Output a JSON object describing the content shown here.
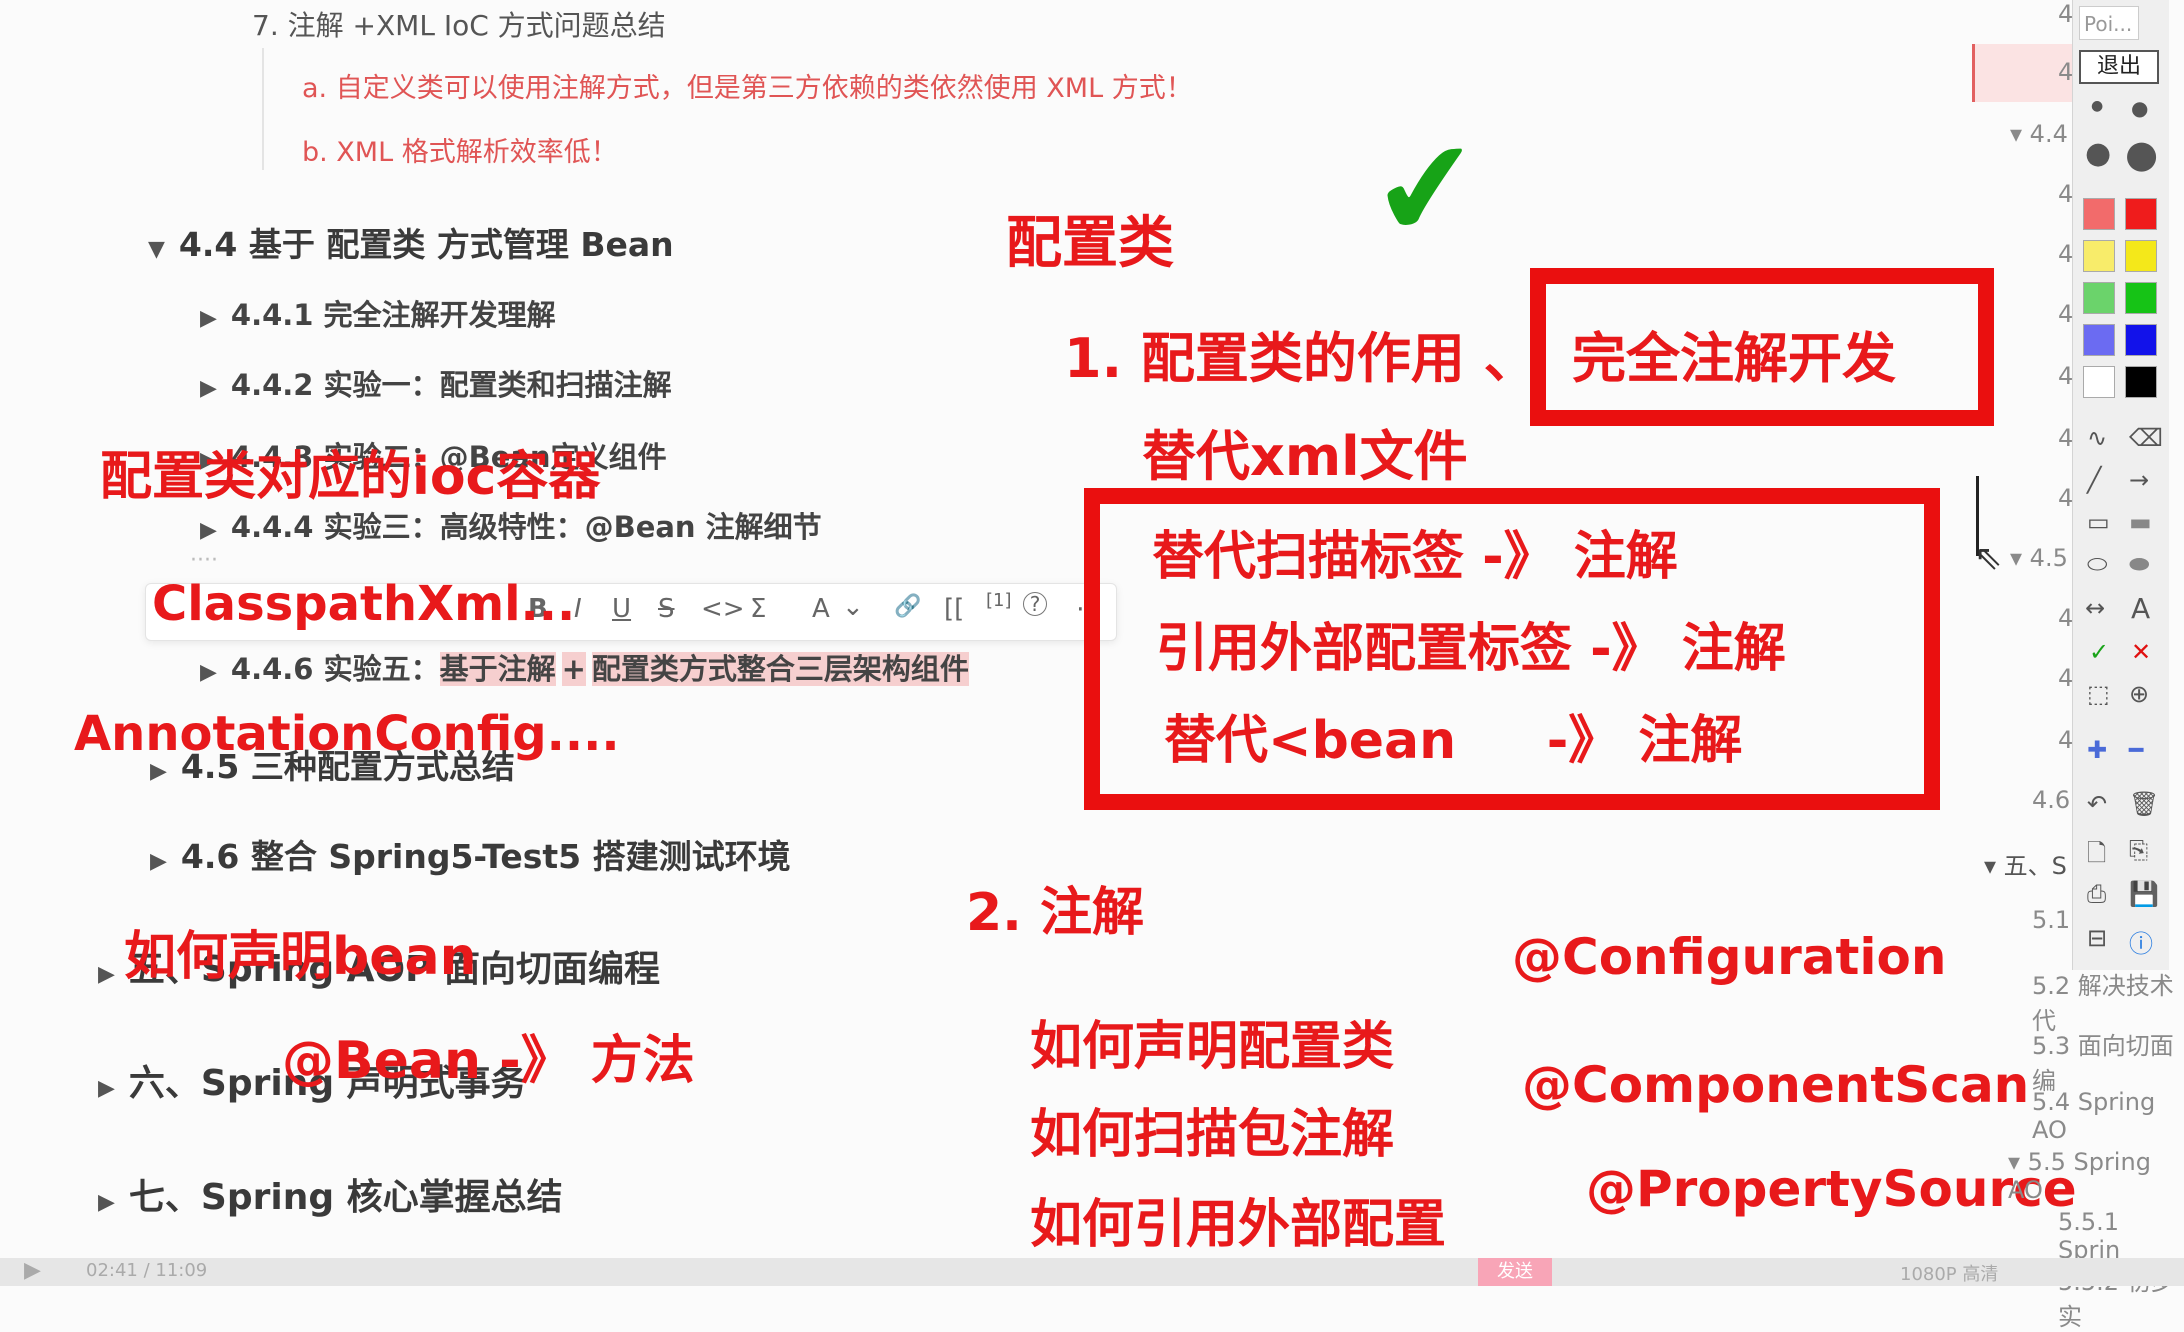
{
  "outline": {
    "item7": "7. 注解 +XML IoC 方式问题总结",
    "item7a": "a. 自定义类可以使用注解方式，但是第三方依赖的类依然使用 XML 方式！",
    "item7b": "b. XML 格式解析效率低！",
    "s44": "4.4 基于 配置类 方式管理 Bean",
    "s441": "4.4.1 完全注解开发理解",
    "s442": "4.4.2 实验一：配置类和扫描注解",
    "s443": "4.4.3 实验二：@Bean定义组件",
    "s444": "4.4.4 实验三：高级特性：@Bean 注解细节",
    "s446_prefix": "4.4.6 实验五：",
    "s446_hl1": "基于注解",
    "s446_plus": "+",
    "s446_hl2": "配置类方式整合三层架构组件",
    "s45": "4.5 三种配置方式总结",
    "s46": "4.6 整合 Spring5-Test5 搭建测试环境",
    "ch5": "五、Spring AOP 面向切面编程",
    "ch6": "六、Spring 声明式事务",
    "ch7": "七、Spring 核心掌握总结",
    "dots": "····"
  },
  "format_toolbar": {
    "bold": "B",
    "italic": "I",
    "underline": "U",
    "strike": "S",
    "code": "<>",
    "sum": "Σ",
    "font": "A",
    "chevron": "⌄",
    "link": "🔗",
    "bracket": "[[",
    "footnote": "[1]",
    "help": "?",
    "more": "⋯"
  },
  "annotations": {
    "peizhilei": "配置类",
    "checkmark": "✔",
    "point1": "1. 配置类的作用 、",
    "full_annotation": "完全注解开发",
    "replace_xml": "替代xml文件",
    "scan_tag": "替代扫描标签 -》 注解",
    "ext_config": "引用外部配置标签 -》 注解",
    "bean_tag": "替代<bean     -》 注解",
    "ioc": "配置类对应的ioc容器",
    "classpath": "ClasspathXml...",
    "annconfig": "AnnotationConfig....",
    "declare_bean": "如何声明bean",
    "bean_method": "@Bean -》 方法",
    "point2": "2. 注解",
    "decl_config": "如何声明配置类",
    "scan_pkg": "如何扫描包注解",
    "ref_ext": "如何引用外部配置",
    "configuration": "@Configuration",
    "componentscan": "@ComponentScan",
    "propertysource": "@PropertySource"
  },
  "sidebar": {
    "r1": "4",
    "r2": "4",
    "r44": "▾ 4.4",
    "r4a": "4",
    "r4b": "4",
    "r4c": "4",
    "r4d": "4",
    "r4e": "4",
    "r4f": "4",
    "r45": "▾ 4.5",
    "r4g": "4",
    "r4h": "4",
    "r4i": "4",
    "r46": "4.6",
    "five": "▾ 五、S",
    "s51": "5.1",
    "s52": "5.2 解决技术代",
    "s53": "5.3 面向切面编",
    "s54": "5.4 Spring AO",
    "s55": "▾ 5.5 Spring AO",
    "s551": "5.5.1 Sprin",
    "s552": "5.5.2 初步实"
  },
  "draw_panel": {
    "search_placeholder": "Poi...",
    "exit": "退出",
    "colors": [
      "#f26b6b",
      "#ef1c1c",
      "#f8ec6a",
      "#f4e81a",
      "#6bd36b",
      "#16c316",
      "#6b6bf2",
      "#1212ea",
      "#ffffff",
      "#000000"
    ]
  },
  "player": {
    "time": "02:41 / 11:09",
    "send": "发送",
    "quality": "1080P 高清"
  }
}
